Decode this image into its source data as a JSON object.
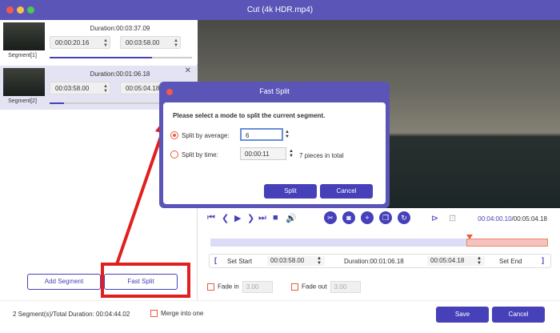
{
  "window": {
    "title": "Cut (4k HDR.mp4)"
  },
  "segments": [
    {
      "label": "Segment[1]",
      "duration": "Duration:00:03:37.09",
      "start": "00:00:20.16",
      "end": "00:03:58.00",
      "progress_fraction": 0.72
    },
    {
      "label": "Segment[2]",
      "duration": "Duration:00:01:06.18",
      "start": "00:03:58.00",
      "end": "00:05:04.18",
      "progress_fraction": 0.1
    }
  ],
  "left_buttons": {
    "add_segment": "Add Segment",
    "fast_split": "Fast Split"
  },
  "dialog": {
    "title": "Fast Split",
    "prompt": "Please select a mode to split the current segment.",
    "option_average": "Split by average:",
    "average_value": "6",
    "option_time": "Split by time:",
    "time_value": "00:00:11",
    "pieces_info": "7 pieces in total",
    "split": "Split",
    "cancel": "Cancel",
    "selected_mode": "average"
  },
  "player": {
    "current_time": "00:04:00.10",
    "total_time": "/00:05:04.18"
  },
  "cut": {
    "set_start": "Set Start",
    "start_time": "00:03:58.00",
    "duration": "Duration:00:01:06.18",
    "end_time": "00:05:04.18",
    "set_end": "Set End"
  },
  "fade": {
    "fade_in": "Fade in",
    "fade_in_value": "3.00",
    "fade_out": "Fade out",
    "fade_out_value": "3.00"
  },
  "footer": {
    "summary": "2 Segment(s)/Total Duration: 00:04:44.02",
    "merge": "Merge into one",
    "save": "Save",
    "cancel": "Cancel"
  },
  "colors": {
    "accent": "#4640b9",
    "titlebar": "#5b55b8",
    "annotation": "#e01f1f",
    "warning": "#e65c3c"
  }
}
